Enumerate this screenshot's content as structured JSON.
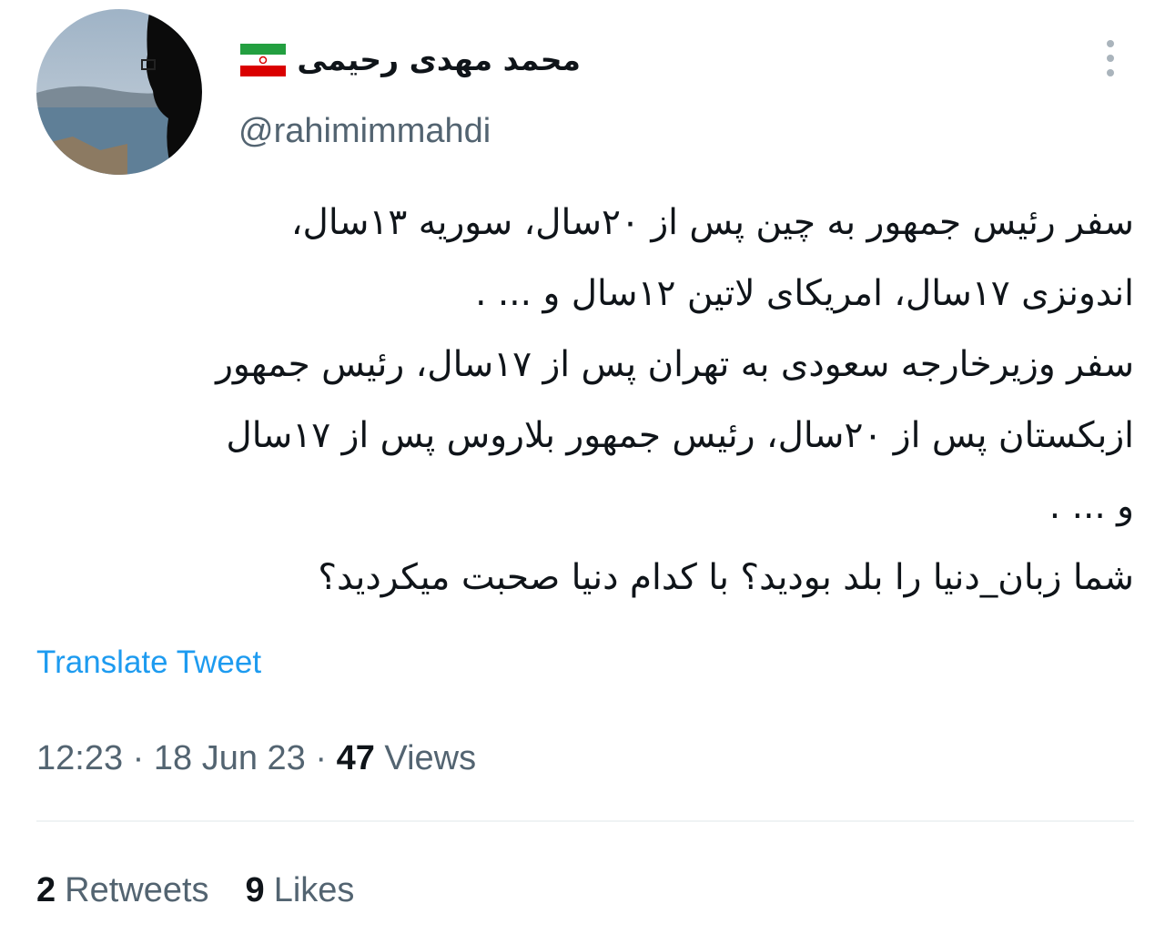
{
  "author": {
    "display_name": "محمد مهدی رحیمی",
    "flag": "iran-flag-icon",
    "handle": "@rahimimmahdi"
  },
  "tweet": {
    "lines": [
      "سفر رئیس جمهور به چین پس از ۲۰سال، سوریه ۱۳سال،",
      "اندونزی ۱۷سال، امریکای لاتین ۱۲سال و ... .",
      "سفر وزیرخارجه سعودی به تهران پس از ۱۷سال، رئیس جمهور",
      "ازبکستان پس از ۲۰سال، رئیس جمهور بلاروس پس از ۱۷سال",
      "و ... .",
      "شما زبان_دنیا را بلد بودید؟ با کدام دنیا صحبت میکردید؟"
    ],
    "translate_label": "Translate Tweet"
  },
  "meta": {
    "time": "12:23",
    "date": "18 Jun 23",
    "separator": "·",
    "views_count": "47",
    "views_label": "Views"
  },
  "stats": {
    "retweets_count": "2",
    "retweets_label": "Retweets",
    "likes_count": "9",
    "likes_label": "Likes"
  },
  "colors": {
    "link": "#1d9bf0",
    "secondary_text": "#536471",
    "primary_text": "#0f1419",
    "divider": "#eff3f4"
  }
}
